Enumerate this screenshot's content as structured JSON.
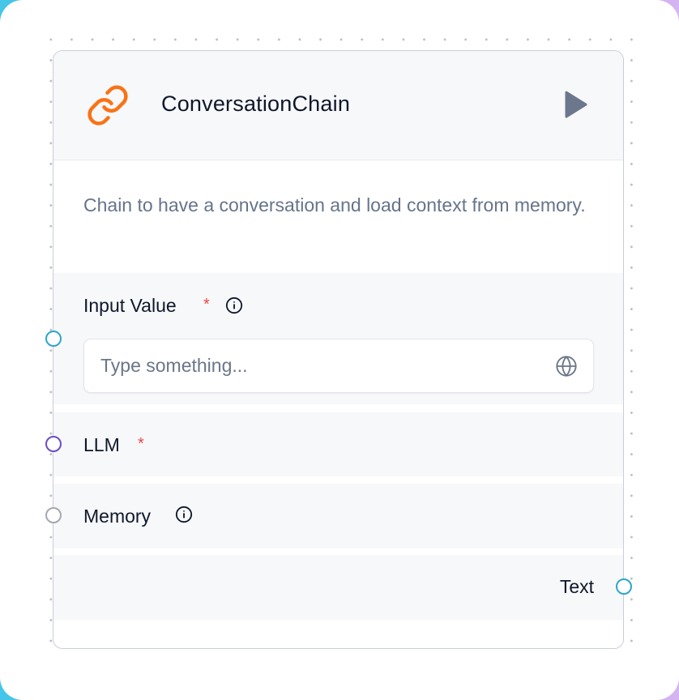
{
  "node": {
    "title": "ConversationChain",
    "description": "Chain to have a conversation and load context from memory.",
    "icon": "link-icon",
    "icon_color": "#f97316",
    "run_icon": "play-icon"
  },
  "fields": {
    "input": {
      "label": "Input Value",
      "required_mark": "*",
      "placeholder": "Type something...",
      "value": "",
      "handle_color": "#2ea6c8"
    },
    "llm": {
      "label": "LLM",
      "required_mark": "*",
      "handle_color": "#6d4cc9"
    },
    "memory": {
      "label": "Memory",
      "handle_color": "#a3a8b1"
    }
  },
  "output": {
    "label": "Text",
    "handle_color": "#2ea6c8"
  }
}
